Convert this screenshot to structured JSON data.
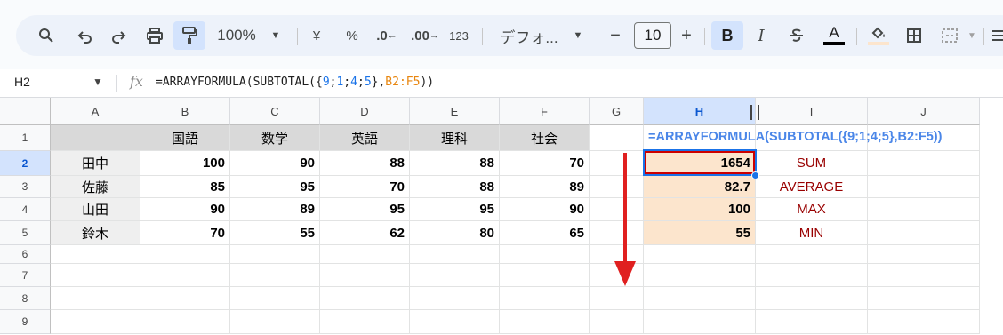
{
  "toolbar": {
    "zoom": "100%",
    "currency": "¥",
    "percent": "%",
    "dec_decrease": ".0",
    "dec_increase": ".00",
    "number_format": "123",
    "font": "デフォ...",
    "font_size": "10",
    "minus": "−",
    "plus": "+",
    "bold": "B",
    "italic": "I",
    "text_color_letter": "A",
    "text_color": "#000000"
  },
  "formula_bar": {
    "cell_ref": "H2",
    "fx": "fx",
    "formula_prefix": "=ARRAYFORMULA(SUBTOTAL({",
    "formula_n1": "9",
    "formula_s1": ";",
    "formula_n2": "1",
    "formula_s2": ";",
    "formula_n3": "4",
    "formula_s3": ";",
    "formula_n4": "5",
    "formula_mid": "},",
    "formula_range": "B2:F5",
    "formula_suffix": "))"
  },
  "sheet": {
    "columns": [
      "A",
      "B",
      "C",
      "D",
      "E",
      "F",
      "G",
      "H",
      "I",
      "J"
    ],
    "rows": [
      "1",
      "2",
      "3",
      "4",
      "5",
      "6",
      "7",
      "8",
      "9"
    ],
    "headers": [
      "国語",
      "数学",
      "英語",
      "理科",
      "社会"
    ],
    "students": [
      {
        "name": "田中",
        "scores": [
          "100",
          "90",
          "88",
          "88",
          "70"
        ]
      },
      {
        "name": "佐藤",
        "scores": [
          "85",
          "95",
          "70",
          "88",
          "89"
        ]
      },
      {
        "name": "山田",
        "scores": [
          "90",
          "89",
          "95",
          "95",
          "90"
        ]
      },
      {
        "name": "鈴木",
        "scores": [
          "70",
          "55",
          "62",
          "80",
          "65"
        ]
      }
    ],
    "h1_formula": "=ARRAYFORMULA(SUBTOTAL({9;1;4;5},B2:F5))",
    "results": [
      "1654",
      "82.7",
      "100",
      "55"
    ],
    "labels": [
      "SUM",
      "AVERAGE",
      "MAX",
      "MIN"
    ]
  },
  "colors": {
    "header_fill": "#d9d9d9",
    "name_fill": "#efefef",
    "result_fill": "#fce5cd",
    "label_color": "#990000",
    "formula_color": "#4a86e8",
    "arrow": "#e02020"
  }
}
